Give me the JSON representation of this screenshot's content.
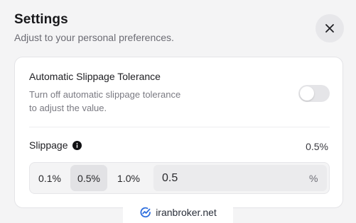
{
  "header": {
    "title": "Settings",
    "subtitle": "Adjust to your personal preferences."
  },
  "auto_slippage": {
    "label": "Automatic Slippage Tolerance",
    "description": "Turn off automatic slippage tolerance\nto adjust the value.",
    "toggle_on": false
  },
  "slippage": {
    "label": "Slippage",
    "current_value": "0.5%",
    "presets": [
      "0.1%",
      "0.5%",
      "1.0%"
    ],
    "selected_preset": "0.5%",
    "input_value": "0.5",
    "unit": "%"
  },
  "watermark": {
    "text": "iranbroker.net"
  },
  "colors": {
    "background": "#f4f4f5",
    "card": "#ffffff",
    "active_preset": "#e2e2e5",
    "watermark_blue": "#2f6fde"
  }
}
